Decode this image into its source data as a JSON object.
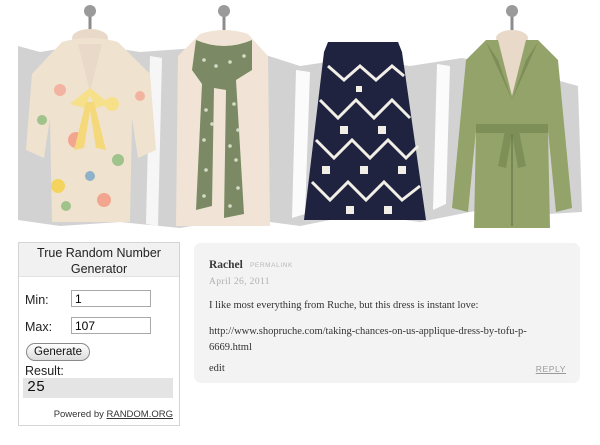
{
  "banner": {
    "products": [
      {
        "name": "floral-bow-blouse"
      },
      {
        "name": "polka-dot-scarf"
      },
      {
        "name": "tribal-print-skirt"
      },
      {
        "name": "green-trench-coat"
      }
    ],
    "colors": {
      "backdrop": "#d2d2d2",
      "mannequin": "#e9d9c9"
    }
  },
  "rng": {
    "title": "True Random Number Generator",
    "min_label": "Min:",
    "min_value": "1",
    "max_label": "Max:",
    "max_value": "107",
    "button_label": "Generate",
    "result_label": "Result:",
    "result_value": "25",
    "powered_by": "Powered by",
    "powered_link": "RANDOM.ORG"
  },
  "comment": {
    "author": "Rachel",
    "permalink": "PERMALINK",
    "date": "April 26, 2011",
    "body": "I like most everything from Ruche, but this dress is instant love:",
    "link": "http://www.shopruche.com/taking-chances-on-us-applique-dress-by-tofu-p-6669.html",
    "edit": "edit",
    "reply": "REPLY",
    "colors": {
      "background": "#f3f3f3"
    }
  }
}
